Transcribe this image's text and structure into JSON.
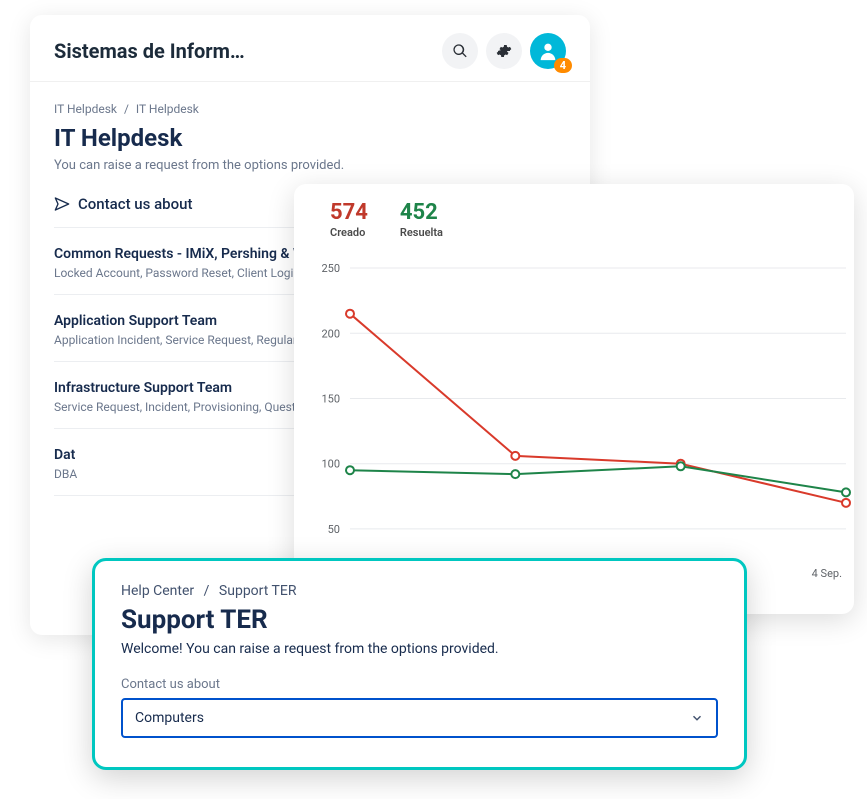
{
  "card1": {
    "app_title": "Sistemas de Inform…",
    "notification_count": "4",
    "breadcrumb": {
      "a": "IT Helpdesk",
      "b": "IT Helpdesk"
    },
    "page_title": "IT Helpdesk",
    "page_subtitle": "You can raise a request from the options provided.",
    "contact_label": "Contact us about",
    "items": [
      {
        "title": "Common Requests - IMiX, Pershing & Wir",
        "desc": "Locked Account, Password Reset, Client Login Issu"
      },
      {
        "title": "Application Support Team",
        "desc": "Application Incident, Service Request, Regular Ser"
      },
      {
        "title": "Infrastructure Support Team",
        "desc": "Service Request, Incident, Provisioning, Question"
      },
      {
        "title": "Dat",
        "desc": "DBA"
      }
    ]
  },
  "card3": {
    "breadcrumb": {
      "a": "Help Center",
      "b": "Support TER"
    },
    "page_title": "Support TER",
    "page_subtitle": "Welcome! You can raise a request from the options provided.",
    "contact_label": "Contact us about",
    "selected": "Computers"
  },
  "chart_data": {
    "type": "line",
    "kpis": [
      {
        "value": "574",
        "label": "Creado",
        "color": "#c0392b"
      },
      {
        "value": "452",
        "label": "Resuelta",
        "color": "#1e8449"
      }
    ],
    "y_ticks": [
      50,
      100,
      150,
      200,
      250
    ],
    "ylim": [
      30,
      260
    ],
    "x_labels": [
      "",
      "",
      "",
      "4 Sep."
    ],
    "series": [
      {
        "name": "Creado",
        "color": "#d93a2b",
        "values": [
          215,
          106,
          100,
          70
        ]
      },
      {
        "name": "Resuelta",
        "color": "#1e8449",
        "values": [
          95,
          92,
          98,
          78
        ]
      }
    ],
    "title": "",
    "xlabel": "",
    "ylabel": ""
  }
}
